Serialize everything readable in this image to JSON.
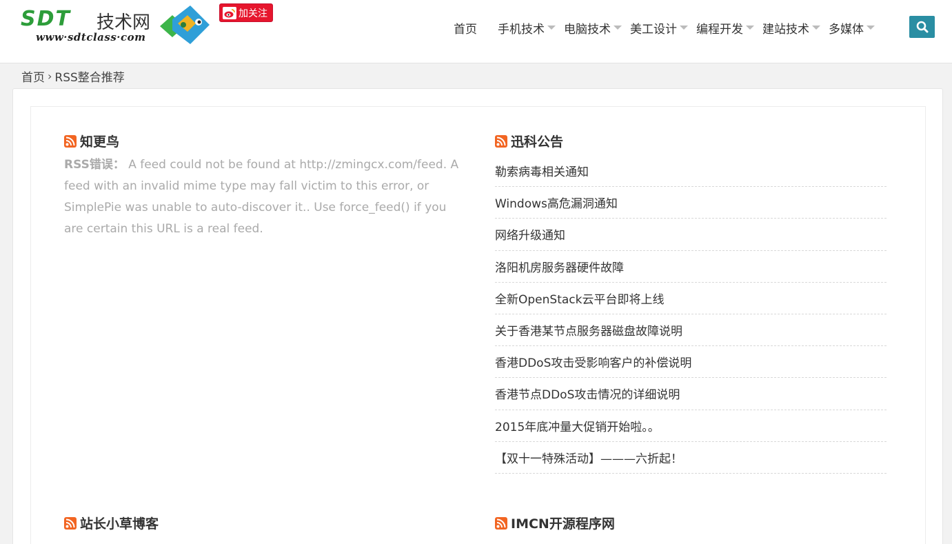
{
  "header": {
    "logo_text": "SDT",
    "logo_cn": "技术网",
    "logo_url": "www·sdtclass·com",
    "weibo_label": "加关注",
    "nav": [
      {
        "label": "首页",
        "has_caret": false
      },
      {
        "label": "手机技术",
        "has_caret": true
      },
      {
        "label": "电脑技术",
        "has_caret": true
      },
      {
        "label": "美工设计",
        "has_caret": true
      },
      {
        "label": "编程开发",
        "has_caret": true
      },
      {
        "label": "建站技术",
        "has_caret": true
      },
      {
        "label": "多媒体",
        "has_caret": true
      }
    ],
    "search_icon": "search-icon"
  },
  "breadcrumb": {
    "home": "首页",
    "separator": "›",
    "current": "RSS整合推荐"
  },
  "feeds": {
    "zhigengniao": {
      "title": "知更鸟",
      "error_label": "RSS错误：",
      "error_text": " A feed could not be found at http://zmingcx.com/feed. A feed with an invalid mime type may fall victim to this error, or SimplePie was unable to auto-discover it.. Use force_feed() if you are certain this URL is a real feed."
    },
    "xunke": {
      "title": "迅科公告",
      "items": [
        "勒索病毒相关通知",
        "Windows高危漏洞通知",
        "网络升级通知",
        "洛阳机房服务器硬件故障",
        "全新OpenStack云平台即将上线",
        "关于香港某节点服务器磁盘故障说明",
        "香港DDoS攻击受影响客户的补偿说明",
        "香港节点DDoS攻击情况的详细说明",
        "2015年底冲量大促销开始啦。。",
        "【双十一特殊活动】———六折起！"
      ]
    },
    "zhanzhang": {
      "title": "站长小草博客"
    },
    "imcn": {
      "title": "IMCN开源程序网"
    }
  },
  "colors": {
    "brand_green": "#2d9d3a",
    "search_bg": "#2a8ea3",
    "weibo_red": "#e6162d",
    "rss_orange": "#f26522"
  }
}
